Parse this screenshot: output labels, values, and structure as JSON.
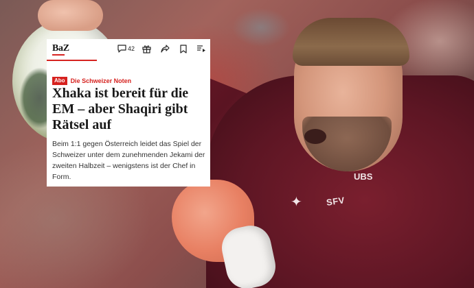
{
  "card": {
    "brand": "BaZ",
    "comment_count": "42",
    "abo_label": "Abo",
    "rubric": "Die Schweizer Noten",
    "headline": "Xhaka ist bereit für die EM – aber Shaqiri gibt Rätsel auf",
    "lead": "Beim 1:1 gegen Österreich leidet das Spiel der Schweizer unter dem zunehmenden Jekami der zweiten Halbzeit – wenigstens ist der Chef in Form."
  },
  "icons": {
    "comment": "comment-icon",
    "gift": "gift-icon",
    "share": "share-icon",
    "bookmark": "bookmark-icon",
    "listen": "listen-icon"
  },
  "photo": {
    "jersey_text": "UBS",
    "crest_text": "SFV"
  },
  "colors": {
    "accent": "#d6221f",
    "card_bg": "#ffffff",
    "jersey": "#6e1a29"
  }
}
